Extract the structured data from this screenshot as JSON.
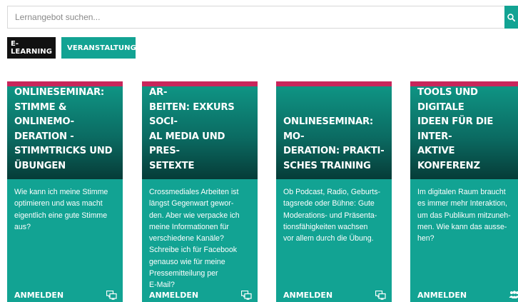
{
  "search": {
    "placeholder": "Lernangebot suchen..."
  },
  "filters": [
    {
      "label": "E-LEARNING"
    },
    {
      "label": "VERANSTALTUNG",
      "remove_label": "×"
    }
  ],
  "cards": [
    {
      "title": "ONLINESEMINAR:\nSTIMME & ONLINEMO-\nDERATION -\nSTIMMTRICKS UND\nÜBUNGEN",
      "text": "Wie kann ich meine Stimme\noptimieren und was macht\neigentlich eine gute Stimme\naus?",
      "cta": "ANMELDEN",
      "icon": "computer-icon"
    },
    {
      "title": "ONLINESEMINAR:\nCROSSMEDIALES AR-\nBEITEN: EXKURS SOCI-\nAL MEDIA UND PRES-\nSETEXTE",
      "text": "Crossmediales Arbeiten ist\nlängst Gegenwart gewor-\nden. Aber wie verpacke ich\nmeine Informationen für\nverschiedene Kanäle?\nSchreibe ich für Facebook\ngenauso wie für meine\nPressemitteilung per\nE-Mail?",
      "cta": "ANMELDEN",
      "icon": "computer-icon"
    },
    {
      "title": "ONLINESEMINAR: MO-\nDERATION: PRAKTI-\nSCHES TRAINING",
      "text": "Ob Podcast, Radio, Geburts-\ntagsrede oder Bühne: Gute\nModerations- und Präsenta-\ntionsfähigkeiten wachsen\nvor allem durch die Übung.",
      "cta": "ANMELDEN",
      "icon": "computer-icon"
    },
    {
      "title": "ONLINESEMINAR:\nTOOLS UND DIGITALE\nIDEEN FÜR DIE INTER-\nAKTIVE KONFERENZ",
      "text": "Im digitalen Raum braucht\nes immer mehr Interaktion,\num das Publikum mitzuneh-\nmen. Wie kann das ausse-\nhen?",
      "cta": "ANMELDEN",
      "icon": "people-icon"
    }
  ],
  "colors": {
    "accent": "#12a393",
    "card_top_border": "#c8265b",
    "chip_dark": "#111111"
  }
}
